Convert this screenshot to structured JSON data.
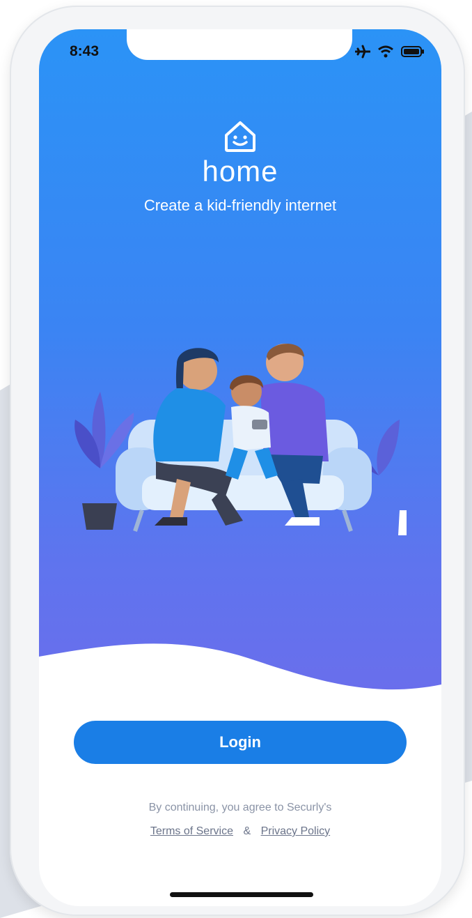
{
  "status_bar": {
    "time": "8:43"
  },
  "brand": {
    "wordmark": "home",
    "tagline": "Create a kid-friendly internet"
  },
  "actions": {
    "login_label": "Login"
  },
  "legal": {
    "agree_text": "By continuing, you agree to Securly's",
    "terms_label": "Terms of Service",
    "separator": "&",
    "privacy_label": "Privacy Policy"
  },
  "icons": {
    "status": [
      "airplane-icon",
      "wifi-icon",
      "battery-icon"
    ],
    "logo": "house-smile-icon"
  },
  "colors": {
    "gradient_top": "#2b93f6",
    "gradient_bottom": "#6a6eec",
    "login_button": "#1a7ee6",
    "legal_text": "#8a93a6"
  }
}
